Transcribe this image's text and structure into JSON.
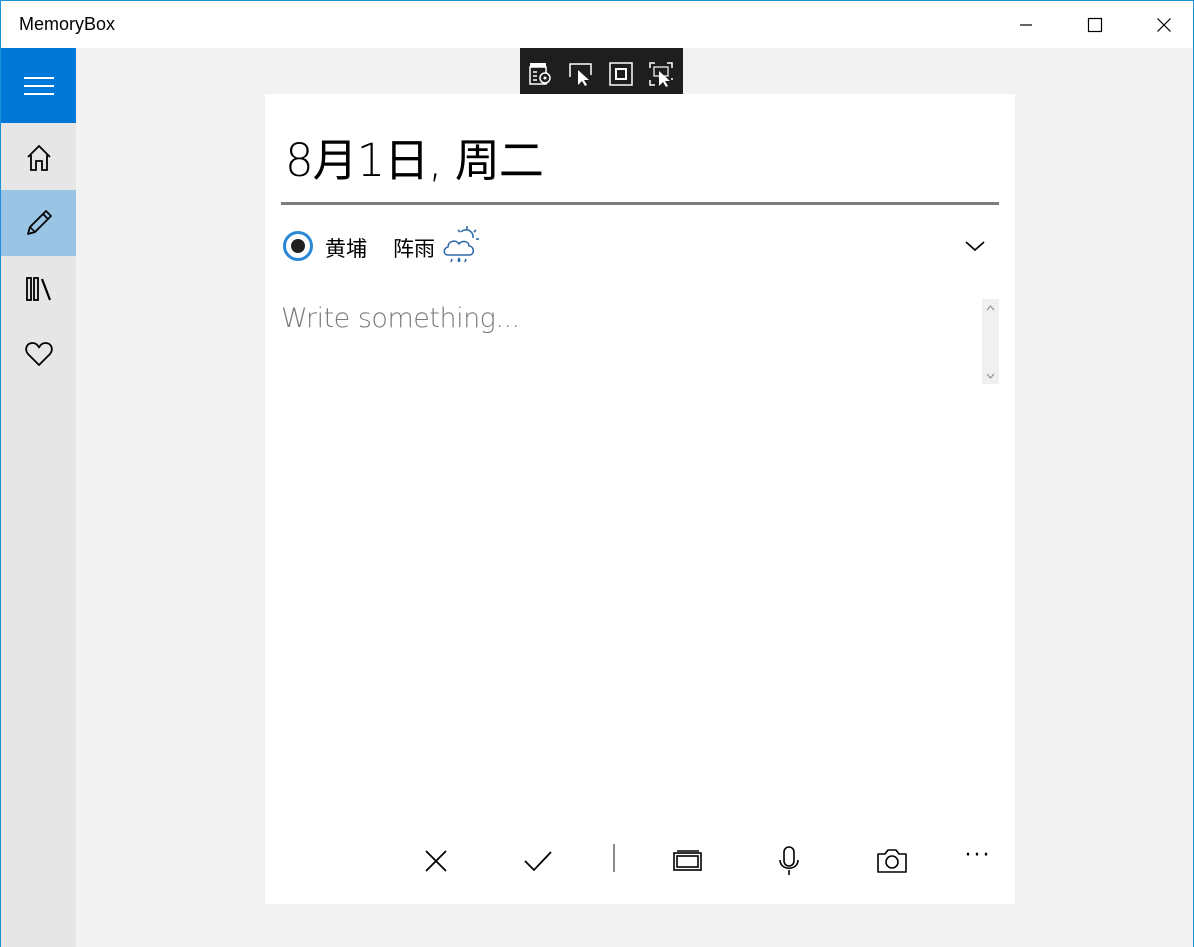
{
  "window": {
    "title": "MemoryBox",
    "controls": [
      "minimize-icon",
      "maximize-icon",
      "close-icon"
    ]
  },
  "sidebar": {
    "items": [
      {
        "name": "menu",
        "icon": "hamburger-icon"
      },
      {
        "name": "home",
        "icon": "home-icon"
      },
      {
        "name": "write",
        "icon": "pencil-icon",
        "selected": true
      },
      {
        "name": "library",
        "icon": "library-icon"
      },
      {
        "name": "favorite",
        "icon": "heart-icon"
      }
    ],
    "accent_color": "#0078d7",
    "selected_color": "#99c4e4"
  },
  "debug_toolbar": {
    "icons": [
      "live-visual-tree-icon",
      "select-element-icon",
      "display-layout-adorners-icon",
      "track-focus-icon"
    ]
  },
  "entry": {
    "date_title": "8月1日, 周二",
    "location": "黄埔",
    "weather": "阵雨",
    "weather_icon": "partly-cloudy-rain-icon",
    "body_placeholder": "Write something..."
  },
  "actions": {
    "icons": [
      "cancel-icon",
      "accept-icon",
      "gallery-icon",
      "microphone-icon",
      "camera-icon",
      "more-icon"
    ],
    "more_label": "···"
  }
}
